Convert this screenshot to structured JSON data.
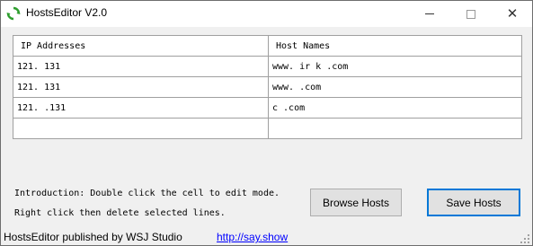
{
  "window": {
    "title": "HostsEditor V2.0",
    "app_icon": "refresh-arrows-icon",
    "controls": {
      "minimize_icon": "minimize-icon",
      "maximize_icon": "maximize-icon",
      "close_icon": "close-icon",
      "close_glyph": "✕"
    }
  },
  "grid": {
    "columns": [
      "IP Addresses",
      "Host Names"
    ],
    "rows": [
      {
        "ip": "121.  131",
        "host": "www.   ir   k  .com"
      },
      {
        "ip": "121.   131",
        "host": "www.   .com"
      },
      {
        "ip": "121.   .131",
        "host": "    c   .com"
      },
      {
        "ip": "",
        "host": ""
      }
    ]
  },
  "introduction": {
    "line1": "Introduction: Double click the cell to edit mode.",
    "line2": "Right click then delete selected lines."
  },
  "buttons": {
    "browse": "Browse Hosts",
    "save": "Save Hosts"
  },
  "status": {
    "text": "HostsEditor published by WSJ Studio",
    "link": "http://say.show"
  },
  "colors": {
    "accent": "#0078d7",
    "link": "#0000ff",
    "window_bg": "#f0f0f0",
    "grid_line": "#a0a0a0",
    "icon_green": "#2e9e2e"
  }
}
